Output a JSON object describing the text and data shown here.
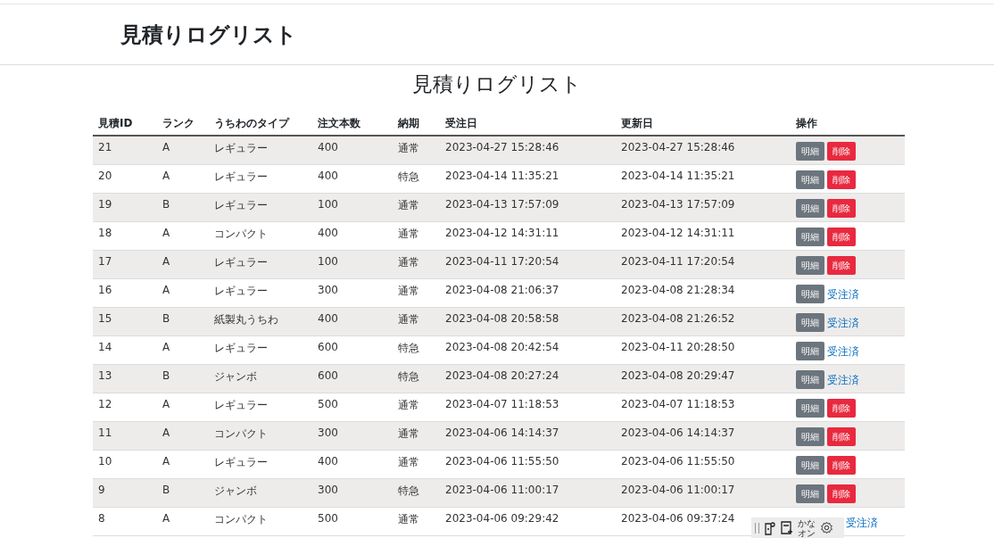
{
  "header": {
    "title": "見積りログリスト"
  },
  "page_title": "見積りログリスト",
  "table": {
    "columns": [
      "見積ID",
      "ランク",
      "うちわのタイプ",
      "注文本数",
      "納期",
      "受注日",
      "更新日",
      "操作"
    ],
    "rows": [
      {
        "cells": [
          "21",
          "A",
          "レギュラー",
          "400",
          "通常",
          "2023-04-27 15:28:46",
          "2023-04-27 15:28:46"
        ],
        "actions": [
          {
            "kind": "detail",
            "label": "明細"
          },
          {
            "kind": "delete",
            "label": "削除"
          }
        ]
      },
      {
        "cells": [
          "20",
          "A",
          "レギュラー",
          "400",
          "特急",
          "2023-04-14 11:35:21",
          "2023-04-14 11:35:21"
        ],
        "actions": [
          {
            "kind": "detail",
            "label": "明細"
          },
          {
            "kind": "delete",
            "label": "削除"
          }
        ]
      },
      {
        "cells": [
          "19",
          "B",
          "レギュラー",
          "100",
          "通常",
          "2023-04-13 17:57:09",
          "2023-04-13 17:57:09"
        ],
        "actions": [
          {
            "kind": "detail",
            "label": "明細"
          },
          {
            "kind": "delete",
            "label": "削除"
          }
        ]
      },
      {
        "cells": [
          "18",
          "A",
          "コンパクト",
          "400",
          "通常",
          "2023-04-12 14:31:11",
          "2023-04-12 14:31:11"
        ],
        "actions": [
          {
            "kind": "detail",
            "label": "明細"
          },
          {
            "kind": "delete",
            "label": "削除"
          }
        ]
      },
      {
        "cells": [
          "17",
          "A",
          "レギュラー",
          "100",
          "通常",
          "2023-04-11 17:20:54",
          "2023-04-11 17:20:54"
        ],
        "actions": [
          {
            "kind": "detail",
            "label": "明細"
          },
          {
            "kind": "delete",
            "label": "削除"
          }
        ]
      },
      {
        "cells": [
          "16",
          "A",
          "レギュラー",
          "300",
          "通常",
          "2023-04-08 21:06:37",
          "2023-04-08 21:28:34"
        ],
        "actions": [
          {
            "kind": "detail",
            "label": "明細"
          },
          {
            "kind": "ordered",
            "label": "受注済"
          }
        ]
      },
      {
        "cells": [
          "15",
          "B",
          "紙製丸うちわ",
          "400",
          "通常",
          "2023-04-08 20:58:58",
          "2023-04-08 21:26:52"
        ],
        "actions": [
          {
            "kind": "detail",
            "label": "明細"
          },
          {
            "kind": "ordered",
            "label": "受注済"
          }
        ]
      },
      {
        "cells": [
          "14",
          "A",
          "レギュラー",
          "600",
          "特急",
          "2023-04-08 20:42:54",
          "2023-04-11 20:28:50"
        ],
        "actions": [
          {
            "kind": "detail",
            "label": "明細"
          },
          {
            "kind": "ordered",
            "label": "受注済"
          }
        ]
      },
      {
        "cells": [
          "13",
          "B",
          "ジャンボ",
          "600",
          "特急",
          "2023-04-08 20:27:24",
          "2023-04-08 20:29:47"
        ],
        "actions": [
          {
            "kind": "detail",
            "label": "明細"
          },
          {
            "kind": "ordered",
            "label": "受注済"
          }
        ]
      },
      {
        "cells": [
          "12",
          "A",
          "レギュラー",
          "500",
          "通常",
          "2023-04-07 11:18:53",
          "2023-04-07 11:18:53"
        ],
        "actions": [
          {
            "kind": "detail",
            "label": "明細"
          },
          {
            "kind": "delete",
            "label": "削除"
          }
        ]
      },
      {
        "cells": [
          "11",
          "A",
          "コンパクト",
          "300",
          "通常",
          "2023-04-06 14:14:37",
          "2023-04-06 14:14:37"
        ],
        "actions": [
          {
            "kind": "detail",
            "label": "明細"
          },
          {
            "kind": "delete",
            "label": "削除"
          }
        ]
      },
      {
        "cells": [
          "10",
          "A",
          "レギュラー",
          "400",
          "通常",
          "2023-04-06 11:55:50",
          "2023-04-06 11:55:50"
        ],
        "actions": [
          {
            "kind": "detail",
            "label": "明細"
          },
          {
            "kind": "delete",
            "label": "削除"
          }
        ]
      },
      {
        "cells": [
          "9",
          "B",
          "ジャンボ",
          "300",
          "特急",
          "2023-04-06 11:00:17",
          "2023-04-06 11:00:17"
        ],
        "actions": [
          {
            "kind": "detail",
            "label": "明細"
          },
          {
            "kind": "delete",
            "label": "削除"
          }
        ]
      },
      {
        "cells": [
          "8",
          "A",
          "コンパクト",
          "500",
          "通常",
          "2023-04-06 09:29:42",
          "2023-04-06 09:37:24"
        ],
        "actions": [
          {
            "kind": "ordered",
            "label": "受注済"
          }
        ]
      }
    ]
  },
  "ime_toolbar": {
    "mode_top": "かな",
    "mode_bottom": "オン"
  }
}
